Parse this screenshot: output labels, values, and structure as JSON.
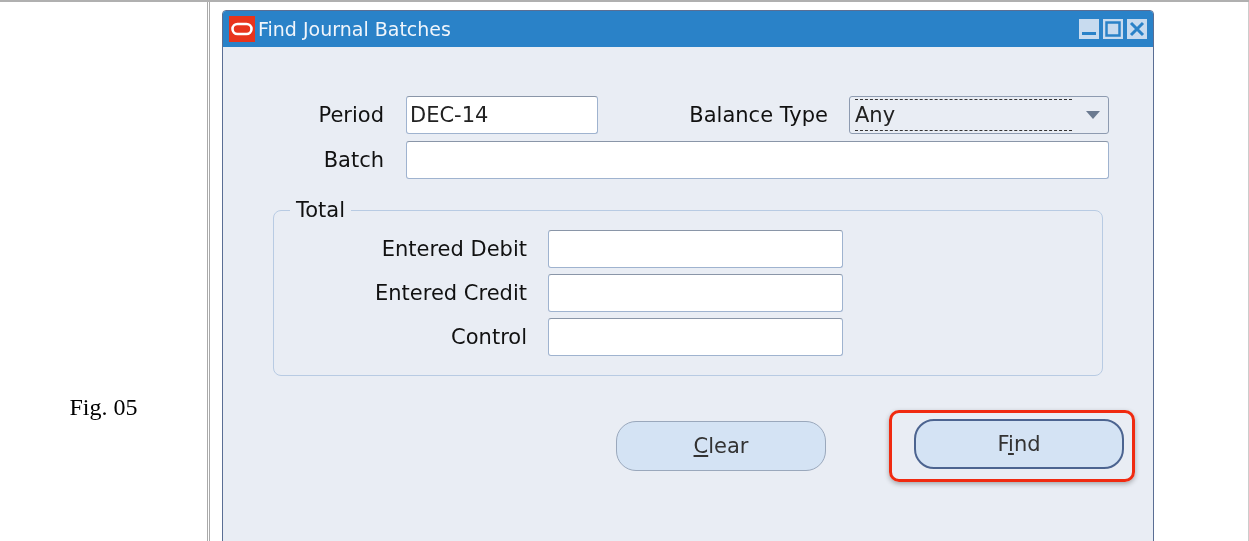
{
  "figure_label": "Fig. 05",
  "window": {
    "title": "Find Journal Batches"
  },
  "fields": {
    "period": {
      "label": "Period",
      "value": "DEC-14"
    },
    "balance_type": {
      "label": "Balance Type",
      "value": "Any"
    },
    "batch": {
      "label": "Batch"
    }
  },
  "total": {
    "title": "Total",
    "fields": [
      {
        "label": "Entered Debit"
      },
      {
        "label": "Entered Credit"
      },
      {
        "label": "Control"
      }
    ]
  },
  "buttons": [
    {
      "mnemonic": "C",
      "after": "lear",
      "default": false,
      "highlighted": false
    },
    {
      "before": "F",
      "mnemonic": "i",
      "after": "nd",
      "default": true,
      "highlighted": true
    }
  ]
}
